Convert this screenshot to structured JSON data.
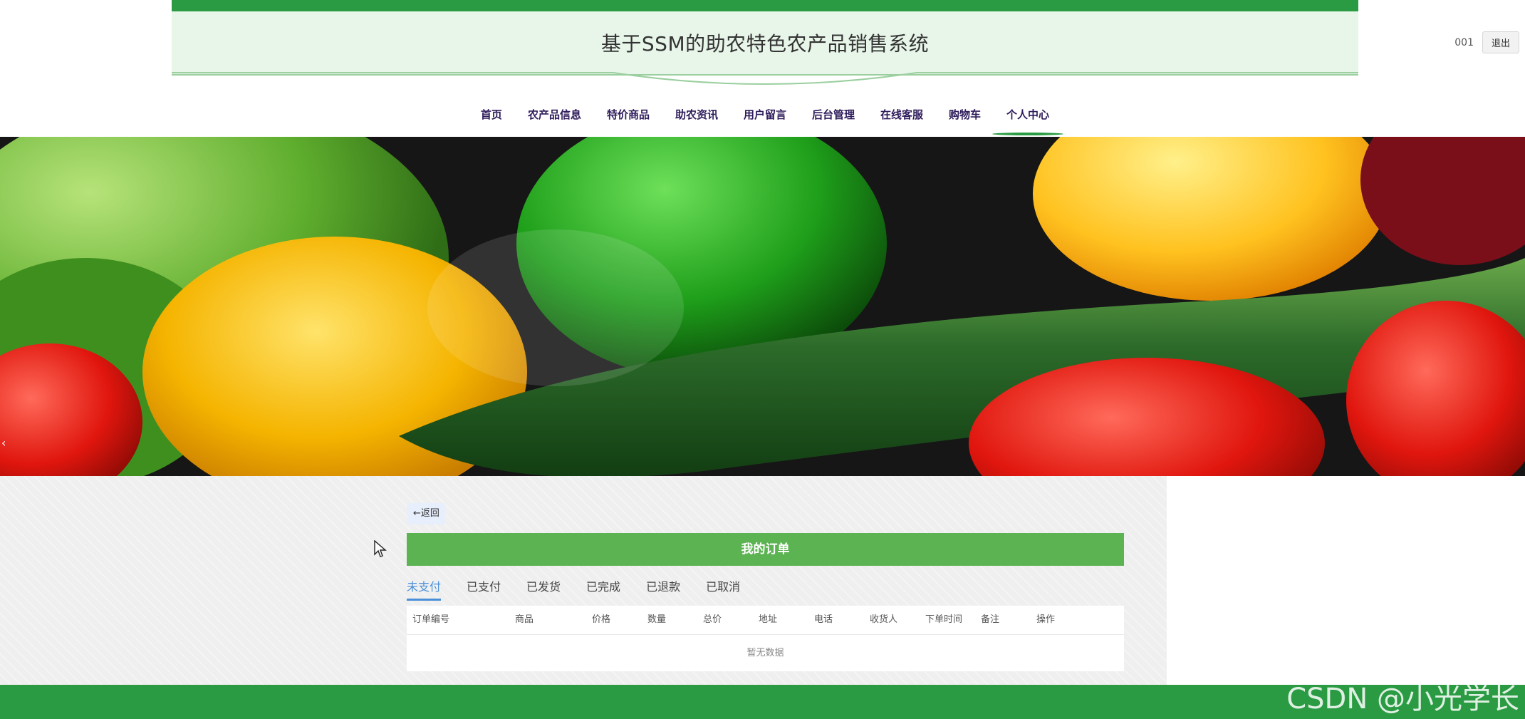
{
  "header": {
    "title": "基于SSM的助农特色农产品销售系统",
    "user_name": "001",
    "logout_label": "退出"
  },
  "nav": {
    "items": [
      {
        "label": "首页"
      },
      {
        "label": "农产品信息"
      },
      {
        "label": "特价商品"
      },
      {
        "label": "助农资讯"
      },
      {
        "label": "用户留言"
      },
      {
        "label": "后台管理"
      },
      {
        "label": "在线客服"
      },
      {
        "label": "购物车"
      },
      {
        "label": "个人中心"
      }
    ],
    "active_index": 8
  },
  "carousel": {
    "prev_label": "‹",
    "slide_count": 3,
    "active_slide": 1
  },
  "orders": {
    "back_label": "←返回",
    "title": "我的订单",
    "tabs": [
      "未支付",
      "已支付",
      "已发货",
      "已完成",
      "已退款",
      "已取消"
    ],
    "active_tab": 0,
    "columns": [
      "订单编号",
      "商品",
      "价格",
      "数量",
      "总价",
      "地址",
      "电话",
      "收货人",
      "下单时间",
      "备注",
      "操作"
    ],
    "empty_text": "暂无数据"
  },
  "watermark": "CSDN @小光学长",
  "colors": {
    "brand_green": "#2a9b42",
    "order_header_green": "#5cb352",
    "active_tab_blue": "#4a90d9"
  }
}
